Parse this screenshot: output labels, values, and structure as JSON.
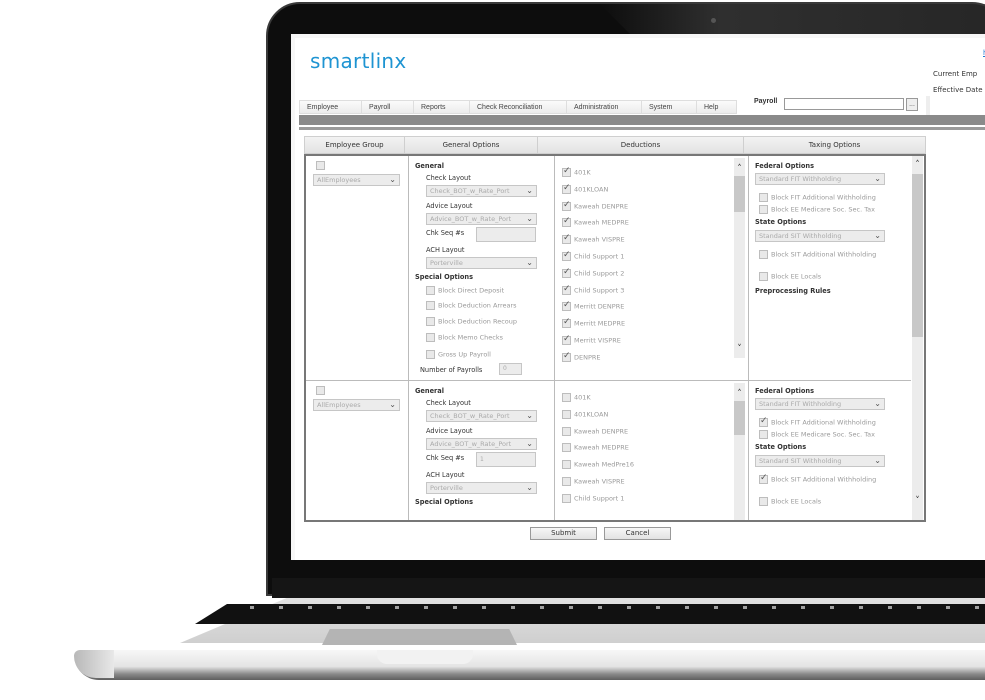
{
  "app": {
    "logo": "smartlinx",
    "corner_link": "h",
    "current_emp_label": "Current Emp",
    "effective_date_label": "Effective Date"
  },
  "menu": {
    "items": [
      "Employee",
      "Payroll",
      "Reports",
      "Check Reconciliation",
      "Administration",
      "System",
      "Help"
    ],
    "payroll_label": "Payroll",
    "payroll_input_value": "",
    "lookup_button": "..."
  },
  "columns": [
    "Employee Group",
    "General Options",
    "Deductions",
    "Taxing Options"
  ],
  "rows": [
    {
      "group_checked": false,
      "employee_group": "AllEmployees",
      "general": {
        "section_general": "General",
        "check_layout_label": "Check Layout",
        "check_layout": "Check_BOT_w_Rate_Port",
        "advice_layout_label": "Advice Layout",
        "advice_layout": "Advice_BOT_w_Rate_Port",
        "chk_seq_label": "Chk Seq #s",
        "chk_seq_value": "",
        "ach_layout_label": "ACH Layout",
        "ach_layout": "Porterville",
        "section_special": "Special Options",
        "special_options": [
          {
            "label": "Block Direct Deposit",
            "checked": false
          },
          {
            "label": "Block Deduction Arrears",
            "checked": false
          },
          {
            "label": "Block Deduction Recoup",
            "checked": false
          },
          {
            "label": "Block Memo Checks",
            "checked": false
          },
          {
            "label": "Gross Up Payroll",
            "checked": false
          }
        ],
        "num_payrolls_label": "Number of Payrolls",
        "num_payrolls_value": "0"
      },
      "deductions": [
        {
          "label": "401K",
          "checked": true
        },
        {
          "label": "401KLOAN",
          "checked": true
        },
        {
          "label": "Kaweah DENPRE",
          "checked": true
        },
        {
          "label": "Kaweah MEDPRE",
          "checked": true
        },
        {
          "label": "Kaweah VISPRE",
          "checked": true
        },
        {
          "label": "Child Support 1",
          "checked": true
        },
        {
          "label": "Child Support 2",
          "checked": true
        },
        {
          "label": "Child Support 3",
          "checked": true
        },
        {
          "label": "Merritt DENPRE",
          "checked": true
        },
        {
          "label": "Merritt MEDPRE",
          "checked": true
        },
        {
          "label": "Merritt VISPRE",
          "checked": true
        },
        {
          "label": "DENPRE",
          "checked": true
        }
      ],
      "taxing": {
        "federal_label": "Federal Options",
        "federal_select": "Standard FIT Withholding",
        "block_fit_additional": {
          "label": "Block FIT Additional Withholding",
          "checked": false
        },
        "block_ee_medicare": {
          "label": "Block EE Medicare Soc. Sec. Tax",
          "checked": false
        },
        "state_label": "State Options",
        "state_select": "Standard SIT Withholding",
        "block_sit_additional": {
          "label": "Block SIT Additional Withholding",
          "checked": false
        },
        "block_ee_locals": {
          "label": "Block EE Locals",
          "checked": false
        },
        "preprocessing_label": "Preprocessing Rules"
      }
    },
    {
      "group_checked": false,
      "employee_group": "AllEmployees",
      "general": {
        "section_general": "General",
        "check_layout_label": "Check Layout",
        "check_layout": "Check_BOT_w_Rate_Port",
        "advice_layout_label": "Advice Layout",
        "advice_layout": "Advice_BOT_w_Rate_Port",
        "chk_seq_label": "Chk Seq #s",
        "chk_seq_value": "1",
        "ach_layout_label": "ACH Layout",
        "ach_layout": "Porterville",
        "section_special": "Special Options"
      },
      "deductions": [
        {
          "label": "401K",
          "checked": false
        },
        {
          "label": "401KLOAN",
          "checked": false
        },
        {
          "label": "Kaweah DENPRE",
          "checked": false
        },
        {
          "label": "Kaweah MEDPRE",
          "checked": false
        },
        {
          "label": "Kaweah MedPre16",
          "checked": false
        },
        {
          "label": "Kaweah VISPRE",
          "checked": false
        },
        {
          "label": "Child Support 1",
          "checked": false
        }
      ],
      "taxing": {
        "federal_label": "Federal Options",
        "federal_select": "Standard FIT Withholding",
        "block_fit_additional": {
          "label": "Block FIT Additional Withholding",
          "checked": true
        },
        "block_ee_medicare": {
          "label": "Block EE Medicare Soc. Sec. Tax",
          "checked": false
        },
        "state_label": "State Options",
        "state_select": "Standard SIT Withholding",
        "block_sit_additional": {
          "label": "Block SIT Additional Withholding",
          "checked": true
        },
        "block_ee_locals": {
          "label": "Block EE Locals",
          "checked": false
        }
      }
    }
  ],
  "actions": {
    "submit": "Submit",
    "cancel": "Cancel"
  }
}
